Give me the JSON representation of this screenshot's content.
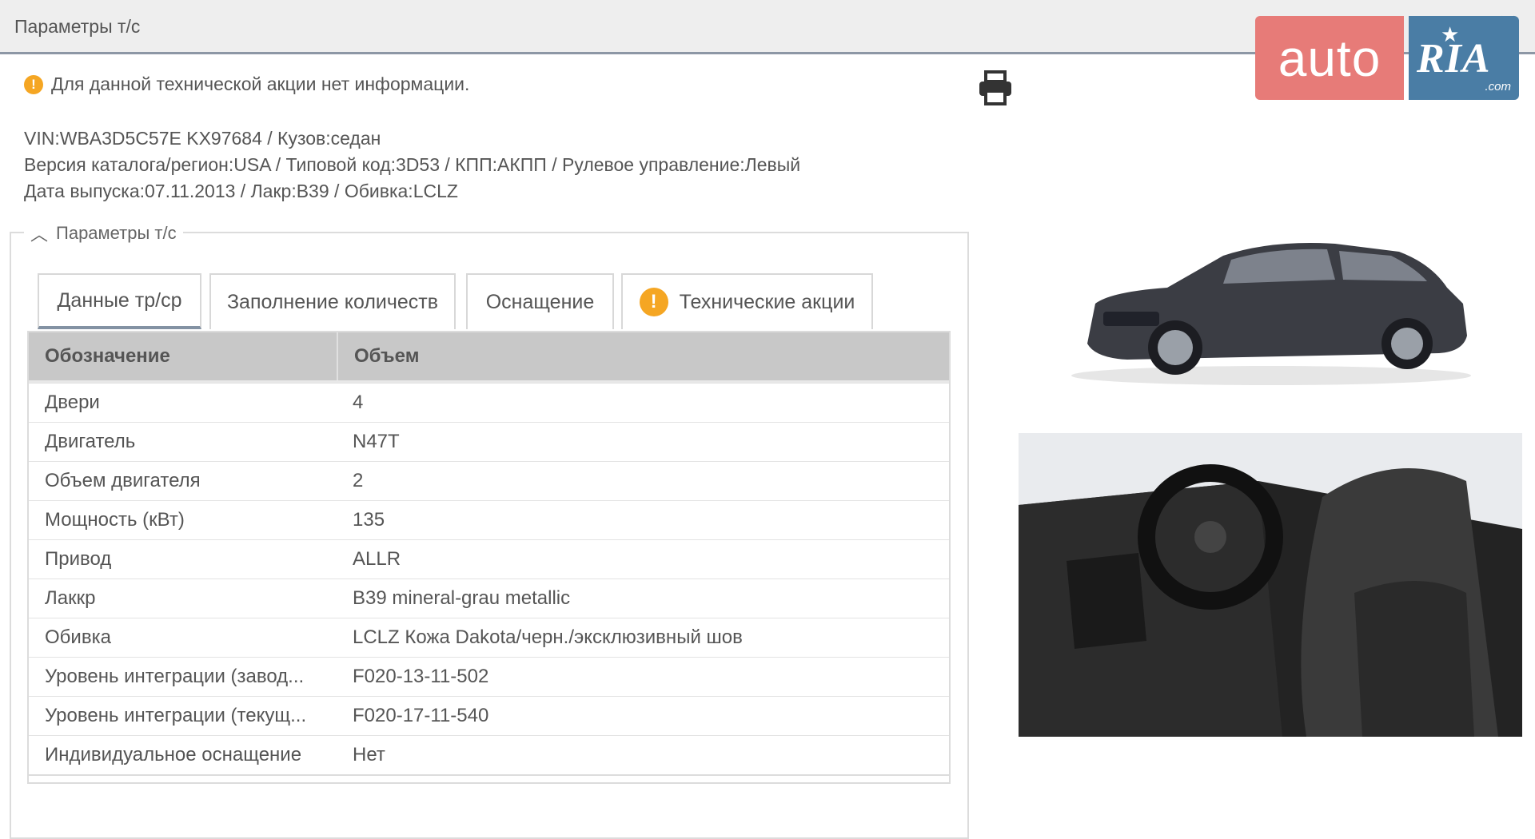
{
  "window": {
    "title": "Параметры т/с",
    "close_label": "✕"
  },
  "logo": {
    "auto": "auto",
    "ria": "RIA",
    "com": ".com"
  },
  "notice": {
    "icon": "warning-icon",
    "text": "Для данной технической акции нет информации."
  },
  "vehicle_meta": {
    "line1": "VIN:WBA3D5C57E KX97684 / Кузов:седан",
    "line2": "Версия каталога/регион:USA / Типовой код:3D53 / КПП:АКПП / Рулевое управление:Левый",
    "line3": "Дата выпуска:07.11.2013 / Лакр:B39 / Обивка:LCLZ"
  },
  "section": {
    "legend": "Параметры т/с"
  },
  "tabs": [
    {
      "label": "Данные тр/ср",
      "active": true
    },
    {
      "label": "Заполнение количеств",
      "active": false
    },
    {
      "label": "Оснащение",
      "active": false
    },
    {
      "label": "Технические акции",
      "active": false,
      "icon": "warning-icon"
    }
  ],
  "table": {
    "headers": [
      "Обозначение",
      "Объем"
    ],
    "rows": [
      [
        "Двери",
        "4"
      ],
      [
        "Двигатель",
        "N47T"
      ],
      [
        "Объем двигателя",
        "2"
      ],
      [
        "Мощность (кВт)",
        "135"
      ],
      [
        "Привод",
        "ALLR"
      ],
      [
        "Лаккр",
        "B39 mineral-grau metallic"
      ],
      [
        "Обивка",
        "LCLZ Кожа Dakota/черн./эксклюзивный шов"
      ],
      [
        "Уровень интеграции (завод...",
        "F020-13-11-502"
      ],
      [
        "Уровень интеграции (текущ...",
        "F020-17-11-540"
      ],
      [
        "Индивидуальное оснащение",
        "Нет"
      ]
    ]
  },
  "colors": {
    "accent": "#8392a3",
    "warning": "#f5a623",
    "logo_auto": "#e77b78",
    "logo_ria": "#4a7da5"
  }
}
